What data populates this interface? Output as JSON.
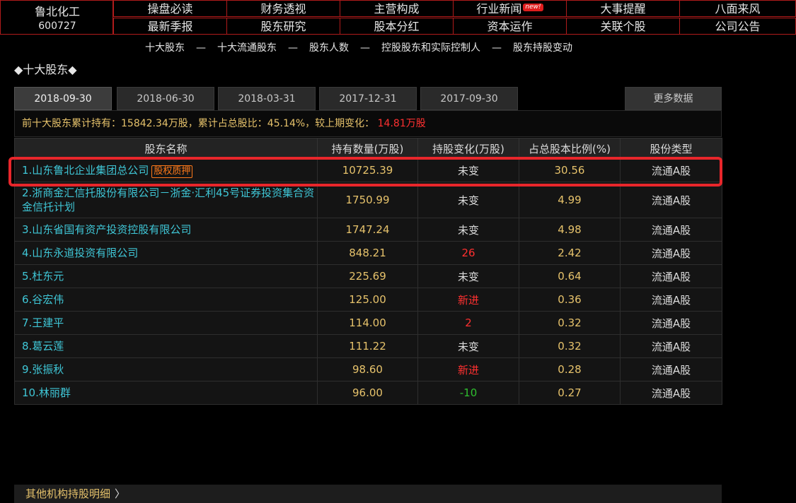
{
  "stock": {
    "name": "鲁北化工",
    "code": "600727"
  },
  "nav": {
    "row1": [
      "操盘必读",
      "财务透视",
      "主营构成",
      "行业新闻",
      "大事提醒",
      "八面来风"
    ],
    "row2": [
      "最新季报",
      "股东研究",
      "股本分红",
      "资本运作",
      "关联个股",
      "公司公告"
    ],
    "new_badge": "new!"
  },
  "sublinks": [
    "十大股东",
    "十大流通股东",
    "股东人数",
    "控股股东和实际控制人",
    "股东持股变动"
  ],
  "sublink_sep": "—",
  "section_title": "◆十大股东◆",
  "tabs": [
    "2018-09-30",
    "2018-06-30",
    "2018-03-31",
    "2017-12-31",
    "2017-09-30"
  ],
  "more_data": "更多数据",
  "summary": {
    "prefix": "前十大股东累计持有：15842.34万股，累计占总股比：45.14%，较上期变化：",
    "change": "14.81万股"
  },
  "table": {
    "headers": [
      "股东名称",
      "持有数量(万股)",
      "持股变化(万股)",
      "占总股本比例(%)",
      "股份类型"
    ],
    "rows": [
      {
        "name": "1.山东鲁北企业集团总公司",
        "tag": "股权质押",
        "qty": "10725.39",
        "change": "未变",
        "change_type": "none",
        "ratio": "30.56",
        "type": "流通A股"
      },
      {
        "name": "2.浙商金汇信托股份有限公司－浙金·汇利45号证券投资集合资金信托计划",
        "tag": "",
        "qty": "1750.99",
        "change": "未变",
        "change_type": "none",
        "ratio": "4.99",
        "type": "流通A股"
      },
      {
        "name": "3.山东省国有资产投资控股有限公司",
        "tag": "",
        "qty": "1747.24",
        "change": "未变",
        "change_type": "none",
        "ratio": "4.98",
        "type": "流通A股"
      },
      {
        "name": "4.山东永道投资有限公司",
        "tag": "",
        "qty": "848.21",
        "change": "26",
        "change_type": "up",
        "ratio": "2.42",
        "type": "流通A股"
      },
      {
        "name": "5.杜东元",
        "tag": "",
        "qty": "225.69",
        "change": "未变",
        "change_type": "none",
        "ratio": "0.64",
        "type": "流通A股"
      },
      {
        "name": "6.谷宏伟",
        "tag": "",
        "qty": "125.00",
        "change": "新进",
        "change_type": "up",
        "ratio": "0.36",
        "type": "流通A股"
      },
      {
        "name": "7.王建平",
        "tag": "",
        "qty": "114.00",
        "change": "2",
        "change_type": "up",
        "ratio": "0.32",
        "type": "流通A股"
      },
      {
        "name": "8.葛云莲",
        "tag": "",
        "qty": "111.22",
        "change": "未变",
        "change_type": "none",
        "ratio": "0.32",
        "type": "流通A股"
      },
      {
        "name": "9.张振秋",
        "tag": "",
        "qty": "98.60",
        "change": "新进",
        "change_type": "up",
        "ratio": "0.28",
        "type": "流通A股"
      },
      {
        "name": "10.林丽群",
        "tag": "",
        "qty": "96.00",
        "change": "-10",
        "change_type": "down",
        "ratio": "0.27",
        "type": "流通A股"
      }
    ]
  },
  "footer_link": "其他机构持股明细",
  "footer_chevron": "〉",
  "colors": {
    "accent_red": "#e8262b",
    "gold": "#e6c26b",
    "cyan": "#3fc6d6",
    "up": "#ff3030",
    "down": "#2fbf2f"
  }
}
